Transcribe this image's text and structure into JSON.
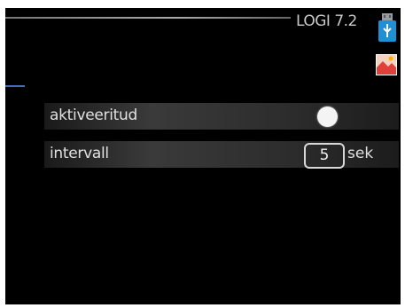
{
  "header": {
    "title": "LOGI 7.2"
  },
  "icons": {
    "usb": "usb-icon",
    "image": "image-icon"
  },
  "settings": {
    "rows": [
      {
        "label": "aktiveeritud",
        "control": "toggle",
        "state": "on"
      },
      {
        "label": "intervall",
        "value": "5",
        "unit": "sek"
      }
    ]
  },
  "colors": {
    "background": "#000000",
    "text": "#e0e0e0",
    "usb_accent": "#1f8fd6",
    "marker": "#4a6ab8"
  }
}
